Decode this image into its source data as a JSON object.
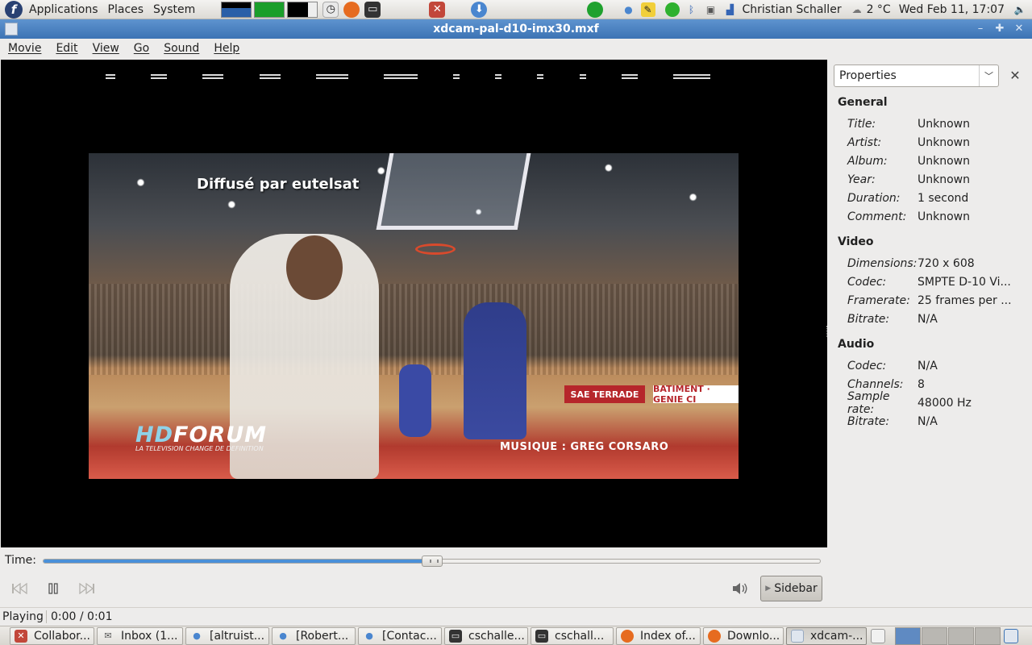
{
  "top_panel": {
    "menus": [
      "Applications",
      "Places",
      "System"
    ],
    "user": "Christian Schaller",
    "temperature": "2 °C",
    "clock": "Wed Feb 11, 17:07"
  },
  "window": {
    "title": "xdcam-pal-d10-imx30.mxf"
  },
  "menu_bar": {
    "items": [
      "Movie",
      "Edit",
      "View",
      "Go",
      "Sound",
      "Help"
    ]
  },
  "video": {
    "caption_top": "Diffusé par eutelsat",
    "logo_hd": "HD",
    "logo_forum": "FORUM",
    "logo_sub": "LA TELEVISION CHANGE DE DEFINITION",
    "music_caption": "MUSIQUE : GREG CORSARO",
    "ad_boards": [
      "SAE TERRADE",
      "BATIMENT · GENIE CI"
    ]
  },
  "sidebar": {
    "selected": "Properties",
    "sections": [
      {
        "heading": "General",
        "rows": [
          {
            "key": "Title:",
            "value": "Unknown"
          },
          {
            "key": "Artist:",
            "value": "Unknown"
          },
          {
            "key": "Album:",
            "value": "Unknown"
          },
          {
            "key": "Year:",
            "value": "Unknown"
          },
          {
            "key": "Duration:",
            "value": "1 second"
          },
          {
            "key": "Comment:",
            "value": "Unknown"
          }
        ]
      },
      {
        "heading": "Video",
        "rows": [
          {
            "key": "Dimensions:",
            "value": "720 x 608"
          },
          {
            "key": "Codec:",
            "value": "SMPTE D-10 Vi..."
          },
          {
            "key": "Framerate:",
            "value": "25 frames per ..."
          },
          {
            "key": "Bitrate:",
            "value": "N/A"
          }
        ]
      },
      {
        "heading": "Audio",
        "rows": [
          {
            "key": "Codec:",
            "value": "N/A"
          },
          {
            "key": "Channels:",
            "value": "8"
          },
          {
            "key": "Sample rate:",
            "value": "48000 Hz"
          },
          {
            "key": "Bitrate:",
            "value": "N/A"
          }
        ]
      }
    ]
  },
  "controls": {
    "time_label": "Time:",
    "seek_fraction": 0.5,
    "sidebar_button": "Sidebar"
  },
  "status": {
    "state": "Playing",
    "time": "0:00 / 0:01"
  },
  "taskbar": {
    "tasks": [
      "Collabor...",
      "Inbox (1...",
      "[altruist...",
      "[Robert...",
      "[Contac...",
      "cschalle...",
      "cschall...",
      "Index of...",
      "Downlo...",
      "xdcam-..."
    ],
    "active_task_index": 9
  },
  "colors": {
    "titlebar": "#3c73b4",
    "seek_fill": "#4a90d9"
  }
}
